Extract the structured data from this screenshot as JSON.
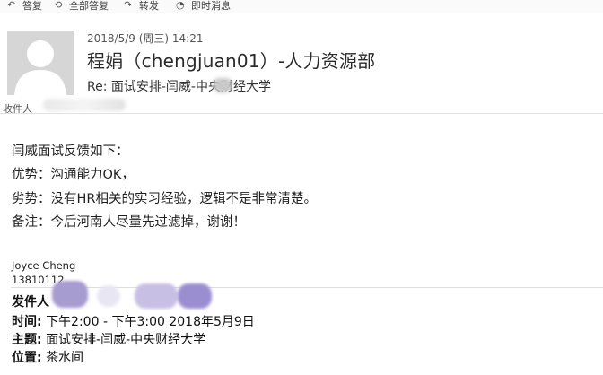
{
  "toolbar": {
    "reply": "答复",
    "reply_all": "全部答复",
    "forward": "转发",
    "im": "即时消息"
  },
  "header": {
    "sent_date": "2018/5/9 (周三) 14:21",
    "sender": "程娟（chengjuan01）-人力资源部",
    "subject": "Re: 面试安排-闫威-中央财经大学",
    "recipients_label": "收件人"
  },
  "body": {
    "lines": [
      "闫威面试反馈如下：",
      "优势：沟通能力OK，",
      "劣势：没有HR相关的实习经验，逻辑不是非常清楚。",
      "备注：今后河南人尽量先过滤掉，谢谢！"
    ],
    "signature_name": "Joyce Cheng",
    "signature_phone": "13810112"
  },
  "quoted": {
    "from_label": "发件人",
    "time_label": "时间:",
    "time_value": "下午2:00 - 下午3:00 2018年5月9日",
    "subject_label": "主题:",
    "subject_value": "面试安排-闫威-中央财经大学",
    "location_label": "位置:",
    "location_value": "茶水间"
  }
}
